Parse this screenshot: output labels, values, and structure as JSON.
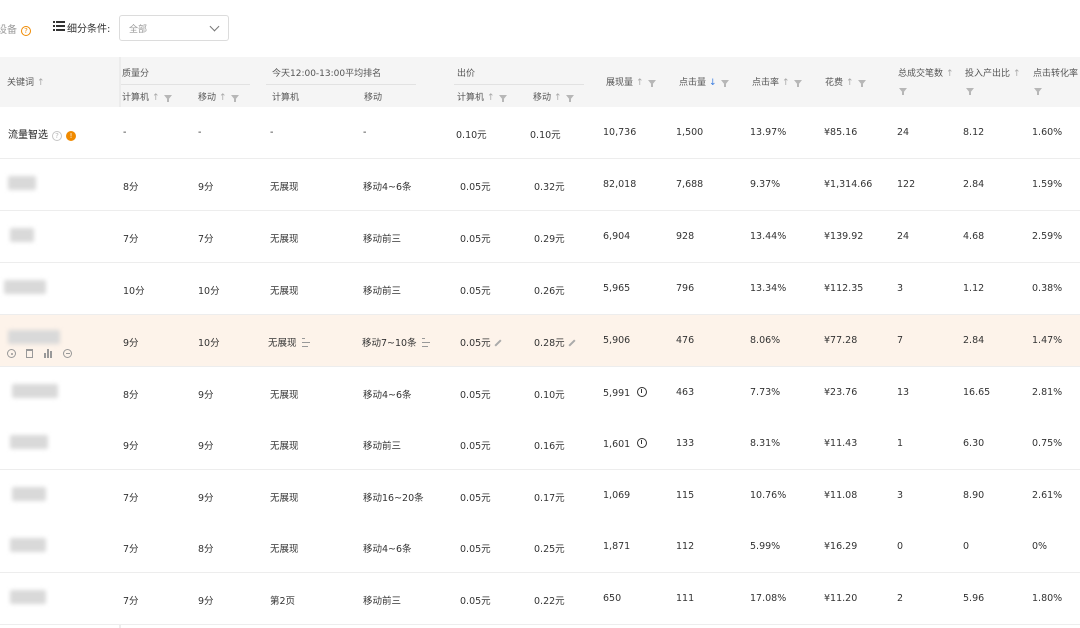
{
  "toolbar": {
    "device_label": "设备",
    "segment_label": "细分条件:",
    "segment_value": "全部"
  },
  "header": {
    "keyword": "关键词",
    "quality": "质量分",
    "quality_pc": "计算机",
    "quality_mobile": "移动",
    "rank_group": "今天12:00-13:00平均排名",
    "rank_pc": "计算机",
    "rank_mobile": "移动",
    "bid_group": "出价",
    "bid_pc": "计算机",
    "bid_mobile": "移动",
    "impressions": "展现量",
    "clicks": "点击量",
    "ctr": "点击率",
    "cost": "花费",
    "transactions": "总成交笔数",
    "roi": "投入产出比",
    "conversion": "点击转化率"
  },
  "rows": [
    {
      "keyword": "流量智选",
      "q_pc": "-",
      "q_m": "-",
      "r_pc": "-",
      "r_m": "-",
      "b_pc": "0.10元",
      "b_m": "0.10元",
      "imp": "10,736",
      "clk": "1,500",
      "ctr": "13.97%",
      "cost": "¥85.16",
      "txn": "24",
      "roi": "8.12",
      "cvr": "1.60%"
    },
    {
      "keyword": "",
      "q_pc": "8分",
      "q_m": "9分",
      "r_pc": "无展现",
      "r_m": "移动4~6条",
      "b_pc": "0.05元",
      "b_m": "0.32元",
      "imp": "82,018",
      "clk": "7,688",
      "ctr": "9.37%",
      "cost": "¥1,314.66",
      "txn": "122",
      "roi": "2.84",
      "cvr": "1.59%"
    },
    {
      "keyword": "",
      "q_pc": "7分",
      "q_m": "7分",
      "r_pc": "无展现",
      "r_m": "移动前三",
      "b_pc": "0.05元",
      "b_m": "0.29元",
      "imp": "6,904",
      "clk": "928",
      "ctr": "13.44%",
      "cost": "¥139.92",
      "txn": "24",
      "roi": "4.68",
      "cvr": "2.59%"
    },
    {
      "keyword": "",
      "q_pc": "10分",
      "q_m": "10分",
      "r_pc": "无展现",
      "r_m": "移动前三",
      "b_pc": "0.05元",
      "b_m": "0.26元",
      "imp": "5,965",
      "clk": "796",
      "ctr": "13.34%",
      "cost": "¥112.35",
      "txn": "3",
      "roi": "1.12",
      "cvr": "0.38%"
    },
    {
      "keyword": "",
      "q_pc": "9分",
      "q_m": "10分",
      "r_pc": "无展现",
      "r_m": "移动7~10条",
      "b_pc": "0.05元",
      "b_m": "0.28元",
      "imp": "5,906",
      "clk": "476",
      "ctr": "8.06%",
      "cost": "¥77.28",
      "txn": "7",
      "roi": "2.84",
      "cvr": "1.47%"
    },
    {
      "keyword": "",
      "q_pc": "8分",
      "q_m": "9分",
      "r_pc": "无展现",
      "r_m": "移动4~6条",
      "b_pc": "0.05元",
      "b_m": "0.10元",
      "imp": "5,991",
      "clk": "463",
      "ctr": "7.73%",
      "cost": "¥23.76",
      "txn": "13",
      "roi": "16.65",
      "cvr": "2.81%"
    },
    {
      "keyword": "",
      "q_pc": "9分",
      "q_m": "9分",
      "r_pc": "无展现",
      "r_m": "移动前三",
      "b_pc": "0.05元",
      "b_m": "0.16元",
      "imp": "1,601",
      "clk": "133",
      "ctr": "8.31%",
      "cost": "¥11.43",
      "txn": "1",
      "roi": "6.30",
      "cvr": "0.75%"
    },
    {
      "keyword": "",
      "q_pc": "7分",
      "q_m": "9分",
      "r_pc": "无展现",
      "r_m": "移动16~20条",
      "b_pc": "0.05元",
      "b_m": "0.17元",
      "imp": "1,069",
      "clk": "115",
      "ctr": "10.76%",
      "cost": "¥11.08",
      "txn": "3",
      "roi": "8.90",
      "cvr": "2.61%"
    },
    {
      "keyword": "",
      "q_pc": "7分",
      "q_m": "8分",
      "r_pc": "无展现",
      "r_m": "移动4~6条",
      "b_pc": "0.05元",
      "b_m": "0.25元",
      "imp": "1,871",
      "clk": "112",
      "ctr": "5.99%",
      "cost": "¥16.29",
      "txn": "0",
      "roi": "0",
      "cvr": "0%"
    },
    {
      "keyword": "",
      "q_pc": "7分",
      "q_m": "9分",
      "r_pc": "第2页",
      "r_m": "移动前三",
      "b_pc": "0.05元",
      "b_m": "0.22元",
      "imp": "650",
      "clk": "111",
      "ctr": "17.08%",
      "cost": "¥11.20",
      "txn": "2",
      "roi": "5.96",
      "cvr": "1.80%"
    }
  ],
  "icons": {
    "sort_up": "arrow-up-icon",
    "sort_down": "arrow-down-icon",
    "filter": "filter-icon",
    "help": "question-icon",
    "info": "info-icon",
    "edit": "pencil-icon",
    "alert": "alert-icon"
  },
  "colors": {
    "accent": "#f08a00",
    "sort_active": "#3b7de0",
    "highlight_row": "#fdf3ea",
    "header_bg": "#f5f5f5"
  }
}
